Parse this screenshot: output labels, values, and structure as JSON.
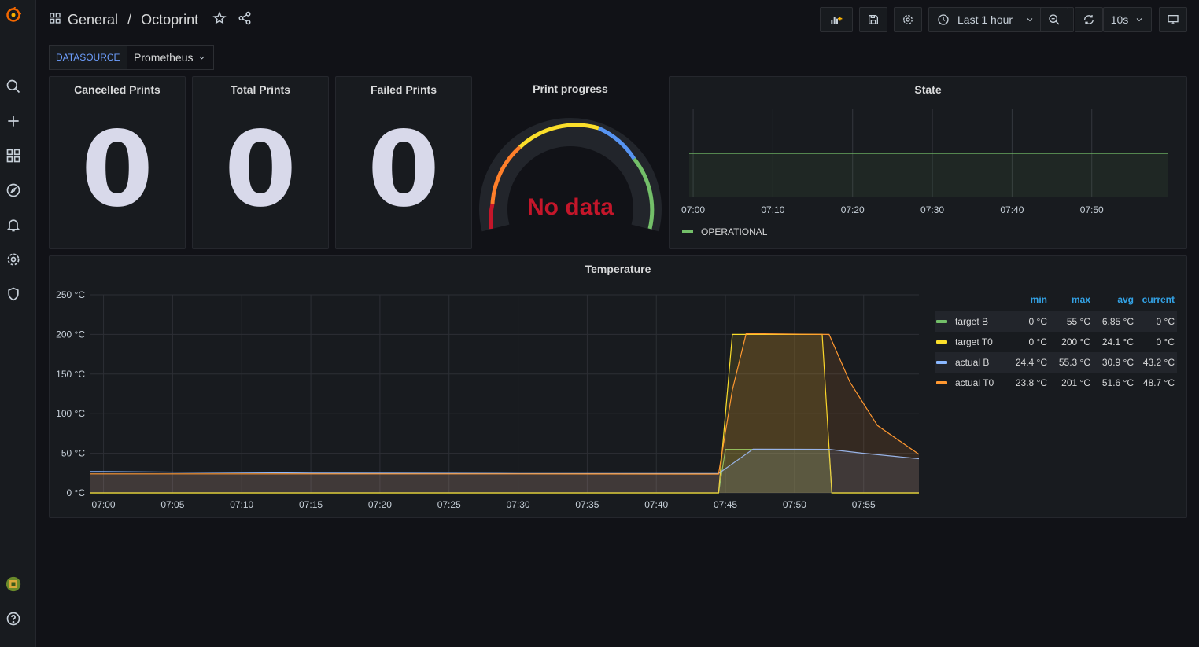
{
  "breadcrumb": {
    "folder": "General",
    "separator": "/",
    "dashboard": "Octoprint"
  },
  "toolbar": {
    "time_range": "Last 1 hour",
    "refresh_interval": "10s"
  },
  "variables": {
    "datasource_label": "DATASOURCE",
    "datasource_value": "Prometheus"
  },
  "panels": {
    "cancelled": {
      "title": "Cancelled Prints",
      "value": "0"
    },
    "total": {
      "title": "Total Prints",
      "value": "0"
    },
    "failed": {
      "title": "Failed Prints",
      "value": "0"
    },
    "progress": {
      "title": "Print progress",
      "status": "No data"
    },
    "state": {
      "title": "State",
      "legend": "OPERATIONAL",
      "x_ticks": [
        "07:00",
        "07:10",
        "07:20",
        "07:30",
        "07:40",
        "07:50"
      ]
    },
    "temperature": {
      "title": "Temperature"
    }
  },
  "colors": {
    "accent": "#6e9fff",
    "green": "#73bf69",
    "yellow": "#fade2a",
    "cyan": "#8ab8ff",
    "orange": "#ff9830",
    "red": "#c4162a"
  },
  "legend": {
    "headers": [
      "min",
      "max",
      "avg",
      "current"
    ],
    "rows": [
      {
        "name": "target B",
        "color": "#73bf69",
        "min": "0 °C",
        "max": "55 °C",
        "avg": "6.85 °C",
        "current": "0 °C"
      },
      {
        "name": "target T0",
        "color": "#fade2a",
        "min": "0 °C",
        "max": "200 °C",
        "avg": "24.1 °C",
        "current": "0 °C"
      },
      {
        "name": "actual B",
        "color": "#8ab8ff",
        "min": "24.4 °C",
        "max": "55.3 °C",
        "avg": "30.9 °C",
        "current": "43.2 °C"
      },
      {
        "name": "actual T0",
        "color": "#ff9830",
        "min": "23.8 °C",
        "max": "201 °C",
        "avg": "51.6 °C",
        "current": "48.7 °C"
      }
    ]
  },
  "chart_data": [
    {
      "type": "line",
      "title": "Temperature",
      "x_ticks": [
        "07:00",
        "07:05",
        "07:10",
        "07:15",
        "07:20",
        "07:25",
        "07:30",
        "07:35",
        "07:40",
        "07:45",
        "07:50",
        "07:55"
      ],
      "y_ticks": [
        "0 °C",
        "50 °C",
        "100 °C",
        "150 °C",
        "200 °C",
        "250 °C"
      ],
      "ylim": [
        0,
        250
      ],
      "xlim": [
        "06:59",
        "07:59"
      ],
      "series": [
        {
          "name": "target B",
          "color": "#73bf69",
          "points": [
            [
              "06:59",
              0
            ],
            [
              "07:44.5",
              0
            ],
            [
              "07:45",
              55
            ],
            [
              "07:52.5",
              55
            ],
            [
              "07:52.7",
              0
            ],
            [
              "07:59",
              0
            ]
          ]
        },
        {
          "name": "target T0",
          "color": "#fade2a",
          "points": [
            [
              "06:59",
              0
            ],
            [
              "07:44.5",
              0
            ],
            [
              "07:45.5",
              200
            ],
            [
              "07:52",
              200
            ],
            [
              "07:52.7",
              0
            ],
            [
              "07:59",
              0
            ]
          ]
        },
        {
          "name": "actual B",
          "color": "#8ab8ff",
          "points": [
            [
              "06:59",
              27
            ],
            [
              "07:15",
              25
            ],
            [
              "07:30",
              24.5
            ],
            [
              "07:44.5",
              24.4
            ],
            [
              "07:47",
              55.3
            ],
            [
              "07:52.5",
              55
            ],
            [
              "07:55",
              50
            ],
            [
              "07:59",
              43.2
            ]
          ]
        },
        {
          "name": "actual T0",
          "color": "#ff9830",
          "points": [
            [
              "06:59",
              24
            ],
            [
              "07:30",
              24
            ],
            [
              "07:44.5",
              23.8
            ],
            [
              "07:45.5",
              130
            ],
            [
              "07:46.5",
              201
            ],
            [
              "07:52.5",
              200
            ],
            [
              "07:54",
              140
            ],
            [
              "07:56",
              85
            ],
            [
              "07:59",
              48.7
            ]
          ]
        }
      ]
    },
    {
      "type": "line",
      "title": "State",
      "x_ticks": [
        "07:00",
        "07:10",
        "07:20",
        "07:30",
        "07:40",
        "07:50"
      ],
      "series": [
        {
          "name": "OPERATIONAL",
          "color": "#73bf69"
        }
      ]
    }
  ]
}
